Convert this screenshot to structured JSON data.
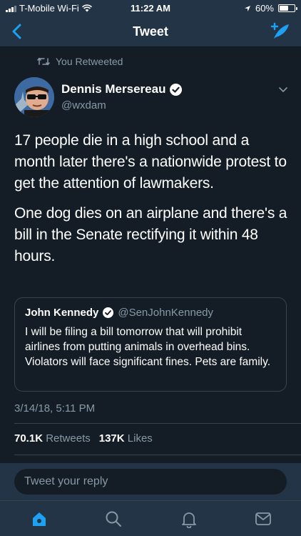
{
  "status_bar": {
    "carrier": "T-Mobile Wi-Fi",
    "time": "11:22 AM",
    "battery": "60%",
    "battery_level": 0.6
  },
  "nav": {
    "title": "Tweet",
    "back_icon": "chevron-left-icon",
    "compose_icon": "compose-feather-icon"
  },
  "retweet_context": "You Retweeted",
  "tweet": {
    "author_name": "Dennis Mersereau",
    "author_handle": "@wxdam",
    "paragraphs": [
      "17 people die in a high school and a month later there's a nationwide protest to get the attention of lawmakers.",
      "One dog dies on an airplane and there's a bill in the Senate rectifying it within 48 hours."
    ],
    "timestamp": "3/14/18, 5:11 PM",
    "retweets": "70.1K",
    "retweets_label": "Retweets",
    "likes": "137K",
    "likes_label": "Likes"
  },
  "quoted_tweet": {
    "author_name": "John Kennedy",
    "author_handle": "@SenJohnKennedy",
    "text": "I will be filing a bill tomorrow that will prohibit airlines from putting animals in overhead bins. Violators will face significant fines. Pets are family."
  },
  "reply": {
    "placeholder": "Tweet your reply"
  },
  "tabs": [
    "home-icon",
    "search-icon",
    "notifications-icon",
    "messages-icon"
  ],
  "colors": {
    "accent": "#1da1f2",
    "background": "#141d26",
    "bar": "#243447",
    "muted": "#8899a6"
  }
}
